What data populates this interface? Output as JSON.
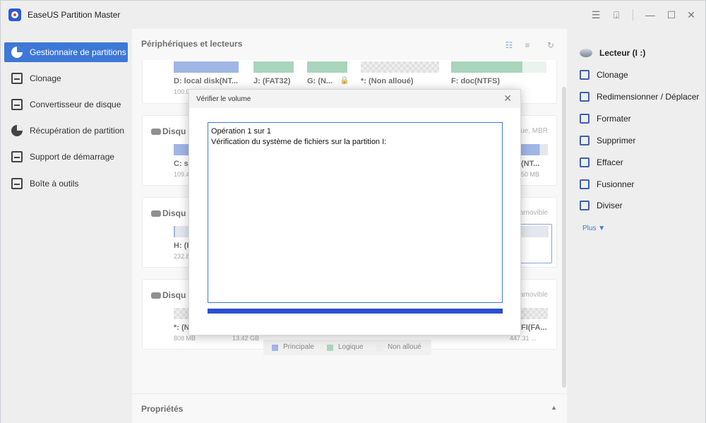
{
  "app": {
    "title": "EaseUS Partition Master"
  },
  "sidebar": {
    "items": [
      {
        "label": "Gestionnaire de partitions",
        "icon": "pie-chart-icon",
        "active": true
      },
      {
        "label": "Clonage",
        "icon": "clone-icon"
      },
      {
        "label": "Convertisseur de disque",
        "icon": "convert-disk-icon"
      },
      {
        "label": "Récupération de partition",
        "icon": "recovery-icon"
      },
      {
        "label": "Support de démarrage",
        "icon": "boot-media-icon"
      },
      {
        "label": "Boîte à outils",
        "icon": "toolbox-icon"
      }
    ]
  },
  "main": {
    "heading": "Périphériques et lecteurs",
    "disk0": {
      "partitions": [
        {
          "name": "D: local disk(NT...",
          "size": "100.0..."
        },
        {
          "name": "J: (FAT32)",
          "size": ""
        },
        {
          "name": "G: (N...",
          "size": ""
        },
        {
          "name": "*: (Non alloué)",
          "size": ""
        },
        {
          "name": "F: doc(NTFS)",
          "size": ""
        }
      ]
    },
    "disk1": {
      "title": "Disqu",
      "meta": "que, MBR",
      "partitions": [
        {
          "name": "C: sy",
          "size": "109.4"
        },
        {
          "name": "(NT...",
          "size": "50 MB"
        }
      ]
    },
    "disk2": {
      "title": "Disqu",
      "meta": "amovible",
      "partitions": [
        {
          "name": "H: (I",
          "size": "232.8"
        }
      ]
    },
    "disk3": {
      "title": "Disqu",
      "meta": "amovible",
      "partitions": [
        {
          "name": "*: (N",
          "size": "808 MB"
        },
        {
          "name": "",
          "size": "13.42 GB"
        },
        {
          "name": "FI(FA...",
          "size": "447.31 ..."
        }
      ]
    },
    "legend": [
      {
        "label": "Principale",
        "color": "#6e8fd8"
      },
      {
        "label": "Logique",
        "color": "#7cbf98"
      },
      {
        "label": "Non alloué",
        "color": "#d9d9d9"
      }
    ],
    "properties_label": "Propriétés"
  },
  "right_panel": {
    "header": "Lecteur (I :)",
    "actions": [
      {
        "label": "Clonage",
        "icon": "clone-icon"
      },
      {
        "label": "Redimensionner / Déplacer",
        "icon": "resize-icon"
      },
      {
        "label": "Formater",
        "icon": "format-icon"
      },
      {
        "label": "Supprimer",
        "icon": "trash-icon"
      },
      {
        "label": "Effacer",
        "icon": "eraser-icon"
      },
      {
        "label": "Fusionner",
        "icon": "merge-icon"
      },
      {
        "label": "Diviser",
        "icon": "split-icon"
      }
    ],
    "more_label": "Plus"
  },
  "dialog": {
    "title": "Vérifier le volume",
    "log_lines": [
      "Opération 1 sur 1",
      "Vérification du système de fichiers sur la partition I:"
    ],
    "progress": 1.0
  }
}
